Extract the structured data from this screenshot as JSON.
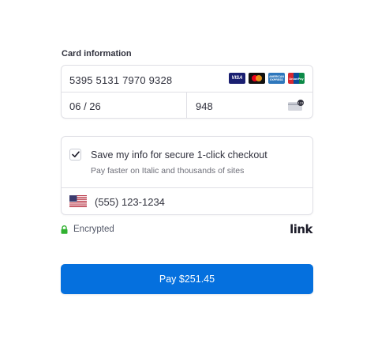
{
  "card_section": {
    "label": "Card information",
    "card_number": "5395 5131 7970 9328",
    "expiry": "06 / 26",
    "cvc": "948",
    "brands": [
      {
        "name": "visa",
        "text": "VISA",
        "color": "#1a1f71"
      },
      {
        "name": "mastercard",
        "text": "",
        "color": "#111111"
      },
      {
        "name": "amex",
        "text": "AMERICAN EXPRESS",
        "color": "#2e77bc"
      },
      {
        "name": "unionpay",
        "text": "UnionPay",
        "color": "#d7282f"
      }
    ],
    "cvc_icon": "cvc-card-icon"
  },
  "link_section": {
    "save_checked": true,
    "save_title": "Save my info for secure 1-click checkout",
    "save_subtitle": "Pay faster on Italic and thousands of sites",
    "phone_country_icon": "us-flag-icon",
    "phone": "(555) 123-1234"
  },
  "footer": {
    "encrypted_label": "Encrypted",
    "lock_icon": "lock-icon",
    "link_logo": "link",
    "lock_color": "#30b130"
  },
  "pay_button": {
    "label": "Pay $251.45",
    "color": "#0570de"
  }
}
